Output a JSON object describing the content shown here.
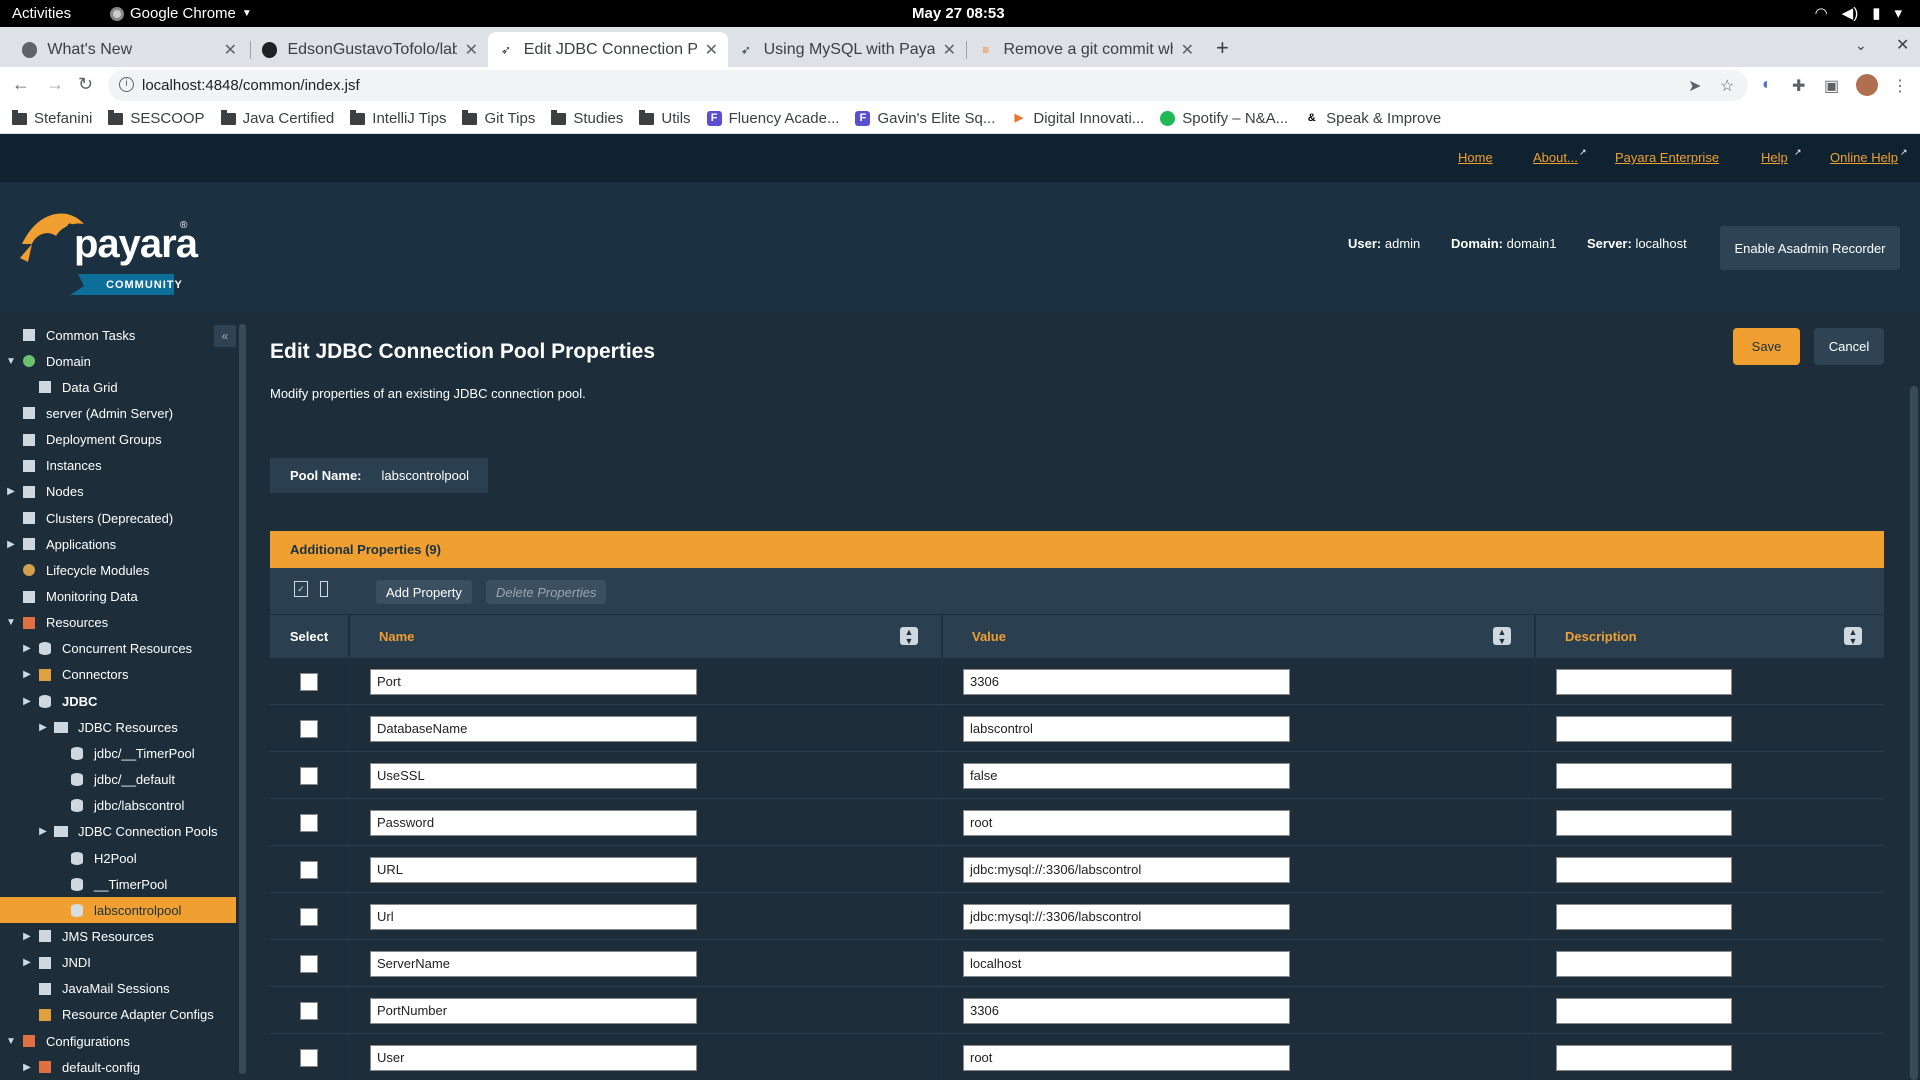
{
  "os": {
    "activities": "Activities",
    "app_name": "Google Chrome",
    "clock": "May 27  08:53"
  },
  "browser": {
    "tabs": [
      {
        "title": "What's New",
        "active": false
      },
      {
        "title": "EdsonGustavoTofolo/labs",
        "active": false
      },
      {
        "title": "Edit JDBC Connection Poo",
        "active": true
      },
      {
        "title": "Using MySQL with Payara",
        "active": false
      },
      {
        "title": "Remove a git commit whic",
        "active": false
      }
    ],
    "url": "localhost:4848/common/index.jsf",
    "bookmarks": [
      "Stefanini",
      "SESCOOP",
      "Java Certified",
      "IntelliJ Tips",
      "Git Tips",
      "Studies",
      "Utils",
      "Fluency Acade...",
      "Gavin's Elite Sq...",
      "Digital Innovati...",
      "Spotify – N&A...",
      "Speak & Improve"
    ]
  },
  "header": {
    "links": [
      "Home",
      "About...",
      "Payara Enterprise",
      "Help",
      "Online Help"
    ],
    "logo_text": "payara",
    "logo_sub": "COMMUNITY",
    "user_label": "User:",
    "user": "admin",
    "domain_label": "Domain:",
    "domain": "domain1",
    "server_label": "Server:",
    "server": "localhost",
    "recorder_btn": "Enable Asadmin Recorder"
  },
  "sidebar": {
    "items": [
      "Common Tasks",
      "Domain",
      "Data Grid",
      "server (Admin Server)",
      "Deployment Groups",
      "Instances",
      "Nodes",
      "Clusters (Deprecated)",
      "Applications",
      "Lifecycle Modules",
      "Monitoring Data",
      "Resources",
      "Concurrent Resources",
      "Connectors",
      "JDBC",
      "JDBC Resources",
      "jdbc/__TimerPool",
      "jdbc/__default",
      "jdbc/labscontrol",
      "JDBC Connection Pools",
      "H2Pool",
      "__TimerPool",
      "labscontrolpool",
      "JMS Resources",
      "JNDI",
      "JavaMail Sessions",
      "Resource Adapter Configs",
      "Configurations",
      "default-config"
    ],
    "selected": "labscontrolpool"
  },
  "page": {
    "title": "Edit JDBC Connection Pool Properties",
    "description": "Modify properties of an existing JDBC connection pool.",
    "save": "Save",
    "cancel": "Cancel",
    "pool_name_label": "Pool Name:",
    "pool_name": "labscontrolpool",
    "section_title": "Additional Properties (9)",
    "add_property": "Add Property",
    "delete_properties": "Delete Properties",
    "columns": {
      "select": "Select",
      "name": "Name",
      "value": "Value",
      "description": "Description"
    },
    "properties": [
      {
        "name": "Port",
        "value": "3306",
        "description": ""
      },
      {
        "name": "DatabaseName",
        "value": "labscontrol",
        "description": ""
      },
      {
        "name": "UseSSL",
        "value": "false",
        "description": ""
      },
      {
        "name": "Password",
        "value": "root",
        "description": ""
      },
      {
        "name": "URL",
        "value": "jdbc:mysql://:3306/labscontrol",
        "description": ""
      },
      {
        "name": "Url",
        "value": "jdbc:mysql://:3306/labscontrol",
        "description": ""
      },
      {
        "name": "ServerName",
        "value": "localhost",
        "description": ""
      },
      {
        "name": "PortNumber",
        "value": "3306",
        "description": ""
      },
      {
        "name": "User",
        "value": "root",
        "description": ""
      }
    ]
  },
  "colors": {
    "accent": "#f0a030",
    "header_bg": "#1b3040",
    "content_bg": "#1d2d3a",
    "panel_bg": "#2a3f4f"
  }
}
